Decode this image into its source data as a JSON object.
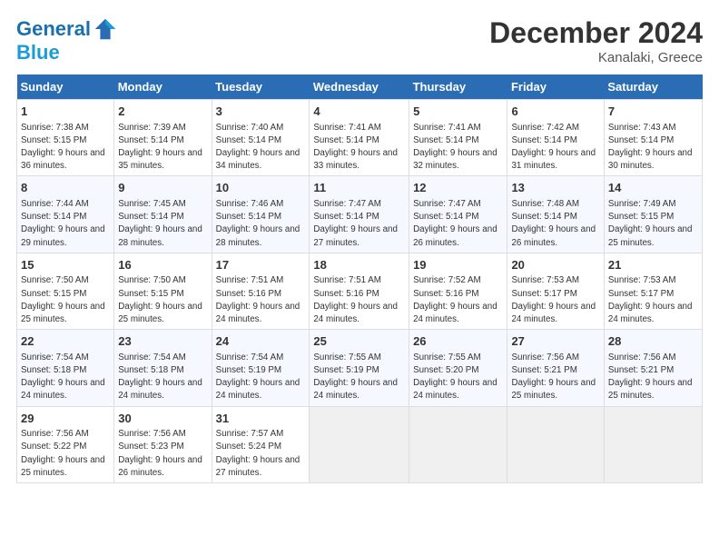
{
  "header": {
    "logo_line1": "General",
    "logo_line2": "Blue",
    "month_title": "December 2024",
    "location": "Kanalaki, Greece"
  },
  "weekdays": [
    "Sunday",
    "Monday",
    "Tuesday",
    "Wednesday",
    "Thursday",
    "Friday",
    "Saturday"
  ],
  "weeks": [
    [
      {
        "day": "1",
        "info": "Sunrise: 7:38 AM\nSunset: 5:15 PM\nDaylight: 9 hours and 36 minutes."
      },
      {
        "day": "2",
        "info": "Sunrise: 7:39 AM\nSunset: 5:14 PM\nDaylight: 9 hours and 35 minutes."
      },
      {
        "day": "3",
        "info": "Sunrise: 7:40 AM\nSunset: 5:14 PM\nDaylight: 9 hours and 34 minutes."
      },
      {
        "day": "4",
        "info": "Sunrise: 7:41 AM\nSunset: 5:14 PM\nDaylight: 9 hours and 33 minutes."
      },
      {
        "day": "5",
        "info": "Sunrise: 7:41 AM\nSunset: 5:14 PM\nDaylight: 9 hours and 32 minutes."
      },
      {
        "day": "6",
        "info": "Sunrise: 7:42 AM\nSunset: 5:14 PM\nDaylight: 9 hours and 31 minutes."
      },
      {
        "day": "7",
        "info": "Sunrise: 7:43 AM\nSunset: 5:14 PM\nDaylight: 9 hours and 30 minutes."
      }
    ],
    [
      {
        "day": "8",
        "info": "Sunrise: 7:44 AM\nSunset: 5:14 PM\nDaylight: 9 hours and 29 minutes."
      },
      {
        "day": "9",
        "info": "Sunrise: 7:45 AM\nSunset: 5:14 PM\nDaylight: 9 hours and 28 minutes."
      },
      {
        "day": "10",
        "info": "Sunrise: 7:46 AM\nSunset: 5:14 PM\nDaylight: 9 hours and 28 minutes."
      },
      {
        "day": "11",
        "info": "Sunrise: 7:47 AM\nSunset: 5:14 PM\nDaylight: 9 hours and 27 minutes."
      },
      {
        "day": "12",
        "info": "Sunrise: 7:47 AM\nSunset: 5:14 PM\nDaylight: 9 hours and 26 minutes."
      },
      {
        "day": "13",
        "info": "Sunrise: 7:48 AM\nSunset: 5:14 PM\nDaylight: 9 hours and 26 minutes."
      },
      {
        "day": "14",
        "info": "Sunrise: 7:49 AM\nSunset: 5:15 PM\nDaylight: 9 hours and 25 minutes."
      }
    ],
    [
      {
        "day": "15",
        "info": "Sunrise: 7:50 AM\nSunset: 5:15 PM\nDaylight: 9 hours and 25 minutes."
      },
      {
        "day": "16",
        "info": "Sunrise: 7:50 AM\nSunset: 5:15 PM\nDaylight: 9 hours and 25 minutes."
      },
      {
        "day": "17",
        "info": "Sunrise: 7:51 AM\nSunset: 5:16 PM\nDaylight: 9 hours and 24 minutes."
      },
      {
        "day": "18",
        "info": "Sunrise: 7:51 AM\nSunset: 5:16 PM\nDaylight: 9 hours and 24 minutes."
      },
      {
        "day": "19",
        "info": "Sunrise: 7:52 AM\nSunset: 5:16 PM\nDaylight: 9 hours and 24 minutes."
      },
      {
        "day": "20",
        "info": "Sunrise: 7:53 AM\nSunset: 5:17 PM\nDaylight: 9 hours and 24 minutes."
      },
      {
        "day": "21",
        "info": "Sunrise: 7:53 AM\nSunset: 5:17 PM\nDaylight: 9 hours and 24 minutes."
      }
    ],
    [
      {
        "day": "22",
        "info": "Sunrise: 7:54 AM\nSunset: 5:18 PM\nDaylight: 9 hours and 24 minutes."
      },
      {
        "day": "23",
        "info": "Sunrise: 7:54 AM\nSunset: 5:18 PM\nDaylight: 9 hours and 24 minutes."
      },
      {
        "day": "24",
        "info": "Sunrise: 7:54 AM\nSunset: 5:19 PM\nDaylight: 9 hours and 24 minutes."
      },
      {
        "day": "25",
        "info": "Sunrise: 7:55 AM\nSunset: 5:19 PM\nDaylight: 9 hours and 24 minutes."
      },
      {
        "day": "26",
        "info": "Sunrise: 7:55 AM\nSunset: 5:20 PM\nDaylight: 9 hours and 24 minutes."
      },
      {
        "day": "27",
        "info": "Sunrise: 7:56 AM\nSunset: 5:21 PM\nDaylight: 9 hours and 25 minutes."
      },
      {
        "day": "28",
        "info": "Sunrise: 7:56 AM\nSunset: 5:21 PM\nDaylight: 9 hours and 25 minutes."
      }
    ],
    [
      {
        "day": "29",
        "info": "Sunrise: 7:56 AM\nSunset: 5:22 PM\nDaylight: 9 hours and 25 minutes."
      },
      {
        "day": "30",
        "info": "Sunrise: 7:56 AM\nSunset: 5:23 PM\nDaylight: 9 hours and 26 minutes."
      },
      {
        "day": "31",
        "info": "Sunrise: 7:57 AM\nSunset: 5:24 PM\nDaylight: 9 hours and 27 minutes."
      },
      null,
      null,
      null,
      null
    ]
  ]
}
